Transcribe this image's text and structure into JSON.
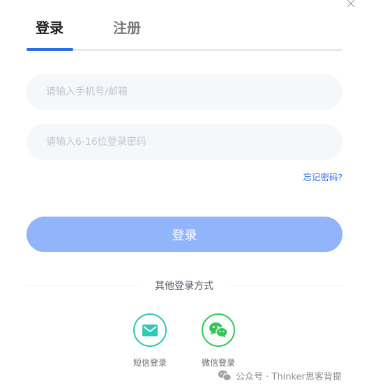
{
  "tabs": {
    "login": "登录",
    "register": "注册"
  },
  "form": {
    "account_placeholder": "请输入手机号/邮箱",
    "password_placeholder": "请输入6-16位登录密码",
    "forgot_password": "忘记密码?",
    "submit": "登录"
  },
  "other_login": {
    "title": "其他登录方式",
    "methods": [
      {
        "label": "短信登录",
        "icon": "envelope-icon",
        "color": "#2fc9b8"
      },
      {
        "label": "微信登录",
        "icon": "wechat-icon",
        "color": "#33c75b"
      }
    ]
  },
  "watermark": {
    "text": "公众号 · Thinker思客背提",
    "icon": "wechat-icon"
  },
  "colors": {
    "accent": "#2a6ee8",
    "button": "#91b4fb",
    "input_bg": "#f5f7fb"
  }
}
